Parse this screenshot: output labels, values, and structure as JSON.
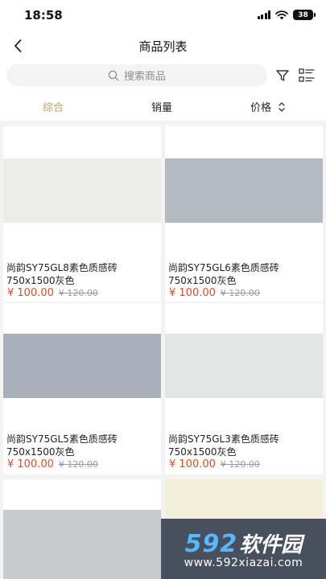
{
  "status_bar": {
    "time": "18:58",
    "battery": "38"
  },
  "nav": {
    "title": "商品列表"
  },
  "search": {
    "placeholder": "搜索商品"
  },
  "sort": {
    "tabs": [
      "综合",
      "销量",
      "价格"
    ],
    "active": 0
  },
  "products": [
    {
      "name": "尚韵SY75GL8素色质感砖750x1500灰色",
      "price": "¥ 100.00",
      "old_price": "¥ 120.00",
      "tile_color": "#ececea"
    },
    {
      "name": "尚韵SY75GL6素色质感砖750x1500灰色",
      "price": "¥ 100.00",
      "old_price": "¥ 120.00",
      "tile_color": "#b4b9c2"
    },
    {
      "name": "尚韵SY75GL5素色质感砖750x1500灰色",
      "price": "¥ 100.00",
      "old_price": "¥ 120.00",
      "tile_color": "#a9b0bc"
    },
    {
      "name": "尚韵SY75GL3素色质感砖750x1500灰色",
      "price": "¥ 100.00",
      "old_price": "¥ 120.00",
      "tile_color": "#e3e4e4"
    },
    {
      "name": "",
      "price": "",
      "old_price": "",
      "tile_color": "#c8cacd"
    },
    {
      "name": "",
      "price": "",
      "old_price": "",
      "tile_color": "#f4efd9"
    }
  ],
  "watermark": {
    "digits": "592",
    "brand": "软件园",
    "url": "www.592xiazai.com"
  },
  "colors": {
    "accent": "#c89a5b",
    "price": "#e04a27",
    "background": "#f3f3f3"
  }
}
